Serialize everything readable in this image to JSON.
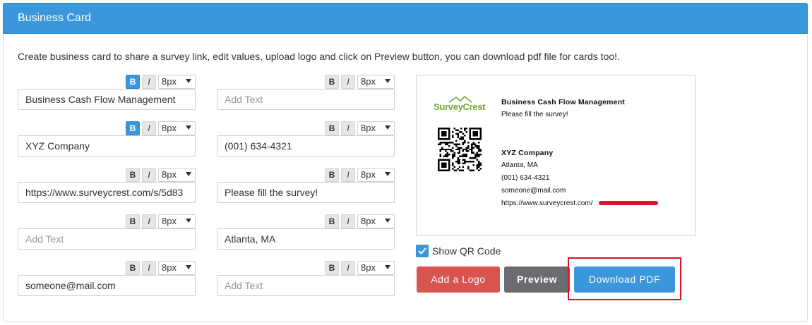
{
  "header": {
    "title": "Business Card"
  },
  "description": "Create business card to share a survey link, edit values, upload logo and click on Preview button, you can download pdf file for cards too!.",
  "toolbar": {
    "bold": "B",
    "italic": "I"
  },
  "fields": [
    {
      "value": "Business Cash Flow Management",
      "placeholder": "",
      "size": "8px",
      "bold_active": true
    },
    {
      "value": "",
      "placeholder": "Add Text",
      "size": "8px",
      "bold_active": false
    },
    {
      "value": "XYZ Company",
      "placeholder": "",
      "size": "8px",
      "bold_active": true
    },
    {
      "value": "(001) 634-4321",
      "placeholder": "",
      "size": "8px",
      "bold_active": false
    },
    {
      "value": "https://www.surveycrest.com/s/5d83",
      "placeholder": "",
      "size": "8px",
      "bold_active": false
    },
    {
      "value": "Please fill the survey!",
      "placeholder": "",
      "size": "8px",
      "bold_active": false
    },
    {
      "value": "",
      "placeholder": "Add Text",
      "size": "8px",
      "bold_active": false
    },
    {
      "value": "Atlanta, MA",
      "placeholder": "",
      "size": "8px",
      "bold_active": false
    },
    {
      "value": "someone@mail.com",
      "placeholder": "",
      "size": "8px",
      "bold_active": false
    },
    {
      "value": "",
      "placeholder": "Add Text",
      "size": "8px",
      "bold_active": false
    }
  ],
  "preview": {
    "logo_text": "SurveyCrest",
    "title": "Business Cash Flow Management",
    "subtitle": "Please fill the survey!",
    "company": "XYZ Company",
    "location": "Atlanta, MA",
    "phone": "(001) 634-4321",
    "email": "someone@mail.com",
    "url": "https://www.surveycrest.com/"
  },
  "show_qr": {
    "label": "Show QR Code",
    "checked": true
  },
  "buttons": {
    "add_logo": "Add a Logo",
    "preview": "Preview",
    "download_pdf": "Download PDF"
  },
  "colors": {
    "primary": "#3a97dc",
    "danger": "#d9534f",
    "secondary": "#6b6c70",
    "highlight": "#d9132a",
    "logo_green": "#6cab35"
  }
}
